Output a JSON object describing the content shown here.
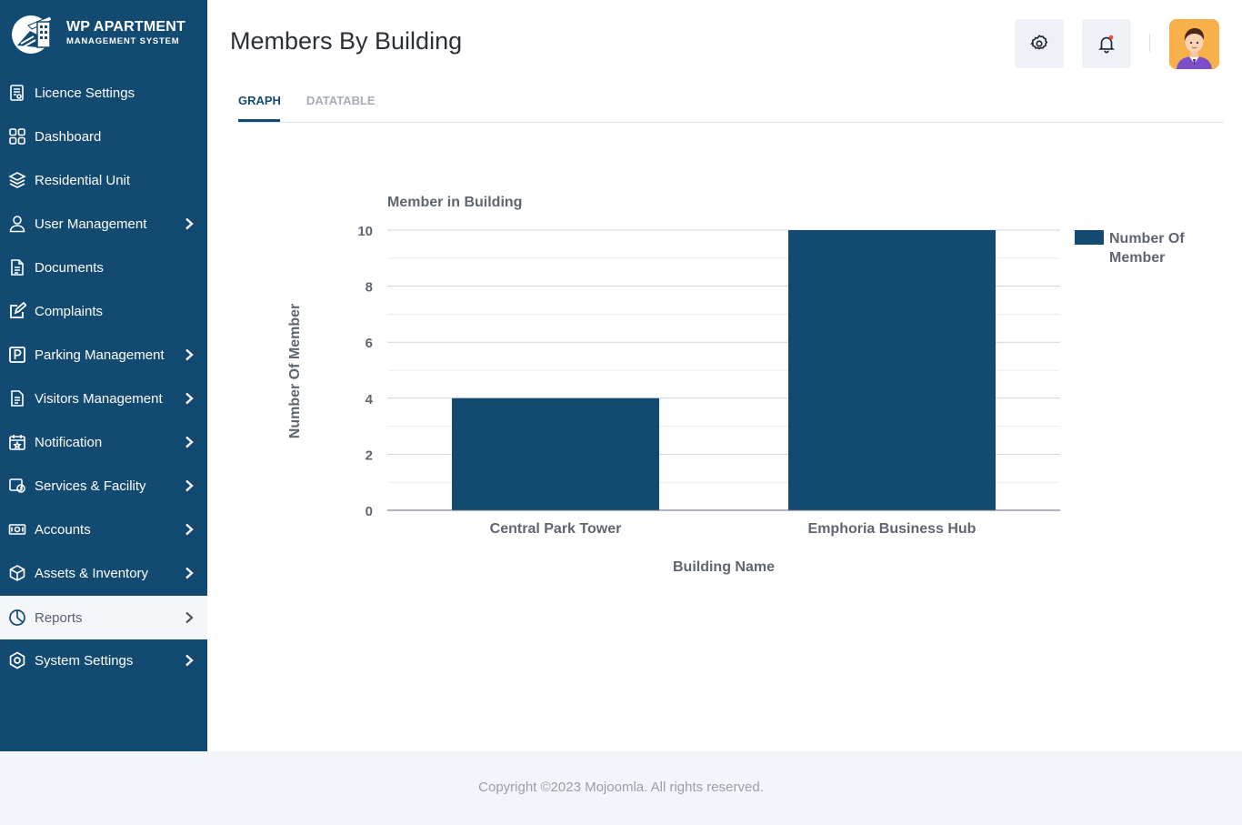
{
  "brand": {
    "title": "WP APARTMENT",
    "subtitle": "MANAGEMENT SYSTEM"
  },
  "sidebar": {
    "items": [
      {
        "label": "Licence Settings",
        "icon": "licence-icon",
        "has_chevron": false
      },
      {
        "label": "Dashboard",
        "icon": "dashboard-icon",
        "has_chevron": false
      },
      {
        "label": "Residential Unit",
        "icon": "layers-icon",
        "has_chevron": false
      },
      {
        "label": "User Management",
        "icon": "user-icon",
        "has_chevron": true
      },
      {
        "label": "Documents",
        "icon": "document-icon",
        "has_chevron": false
      },
      {
        "label": "Complaints",
        "icon": "edit-icon",
        "has_chevron": false
      },
      {
        "label": "Parking Management",
        "icon": "parking-icon",
        "has_chevron": true
      },
      {
        "label": "Visitors Management",
        "icon": "visitors-icon",
        "has_chevron": true
      },
      {
        "label": "Notification",
        "icon": "calendar-star-icon",
        "has_chevron": true
      },
      {
        "label": "Services & Facility",
        "icon": "services-icon",
        "has_chevron": true
      },
      {
        "label": "Accounts",
        "icon": "money-icon",
        "has_chevron": true
      },
      {
        "label": "Assets & Inventory",
        "icon": "box-icon",
        "has_chevron": true
      },
      {
        "label": "Reports",
        "icon": "pie-chart-icon",
        "has_chevron": true,
        "active": true
      },
      {
        "label": "System Settings",
        "icon": "settings-icon",
        "has_chevron": true
      }
    ]
  },
  "header": {
    "title": "Members By Building"
  },
  "tabs": [
    {
      "label": "GRAPH",
      "active": true
    },
    {
      "label": "DATATABLE",
      "active": false
    }
  ],
  "colors": {
    "sidebar_bg": "#134a72",
    "bar": "#134a72",
    "accent": "#134a72",
    "notification_dot": "#e74c3c"
  },
  "chart_data": {
    "type": "bar",
    "title": "Member in Building",
    "categories": [
      "Central Park Tower",
      "Emphoria Business Hub"
    ],
    "series": [
      {
        "name": "Number Of Member",
        "values": [
          4,
          10
        ]
      }
    ],
    "xlabel": "Building Name",
    "ylabel": "Number Of Member",
    "ylim": [
      0,
      10
    ],
    "yticks": [
      0,
      2,
      4,
      6,
      8,
      10
    ],
    "grid": true,
    "legend": "right"
  },
  "footer": {
    "text": "Copyright ©2023 Mojoomla. All rights reserved."
  }
}
